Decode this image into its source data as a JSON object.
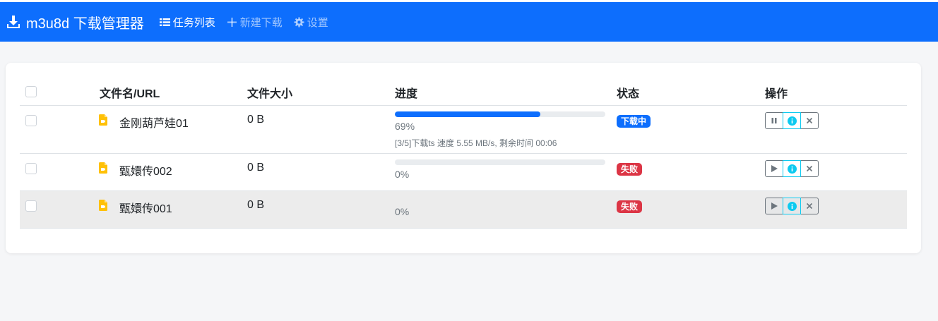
{
  "app": {
    "brand_title": "m3u8d 下载管理器",
    "colors": {
      "primary": "#0d6efd",
      "danger": "#dc3545",
      "info": "#0dcaf0",
      "file_icon": "#ffc107"
    }
  },
  "nav": {
    "items": [
      {
        "label": "任务列表",
        "icon": "list-icon",
        "active": true
      },
      {
        "label": "新建下载",
        "icon": "plus-icon",
        "active": false
      },
      {
        "label": "设置",
        "icon": "gear-icon",
        "active": false
      }
    ]
  },
  "table": {
    "headers": {
      "name": "文件名/URL",
      "size": "文件大小",
      "progress": "进度",
      "status": "状态",
      "actions": "操作"
    },
    "rows": [
      {
        "name": "金刚葫芦娃01",
        "size": "0 B",
        "progress_value": 69,
        "progress_text": "69%",
        "progress_detail": "[3/5]下载ts 速度 5.55 MB/s, 剩余时间 00:06",
        "status": "下载中",
        "status_color": "#0d6efd",
        "actions": [
          "pause-icon",
          "info-icon",
          "close-icon"
        ]
      },
      {
        "name": "甄嬛传002",
        "size": "0 B",
        "progress_value": 0,
        "progress_text": "0%",
        "status": "失败",
        "status_color": "#dc3545",
        "actions": [
          "play-icon",
          "info-icon",
          "close-icon"
        ]
      },
      {
        "name": "甄嬛传001",
        "size": "0 B",
        "progress_text": "0%",
        "status": "失败",
        "status_color": "#dc3545",
        "actions": [
          "play-icon",
          "info-icon",
          "close-icon"
        ],
        "hovered": true
      }
    ]
  }
}
